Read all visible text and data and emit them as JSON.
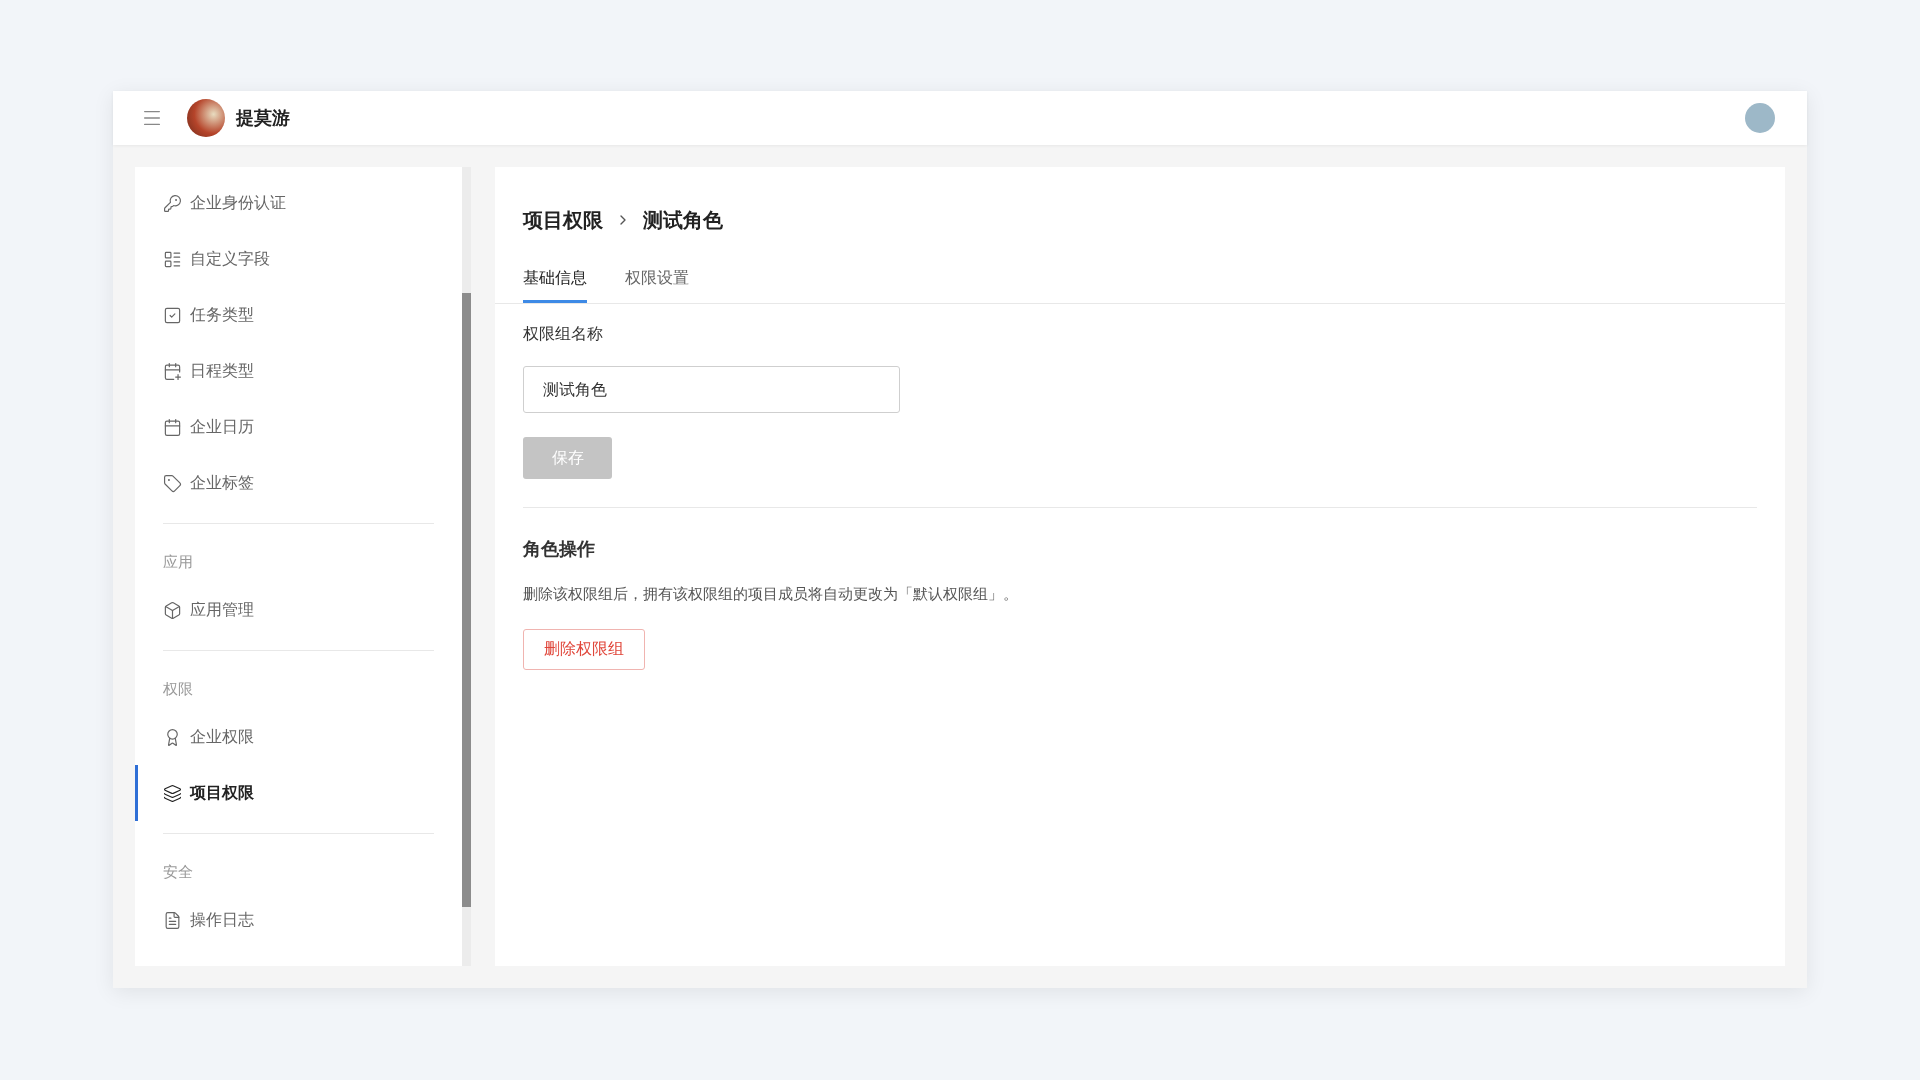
{
  "header": {
    "title": "提莫游"
  },
  "sidebar": {
    "groups": [
      {
        "items": [
          {
            "label": "企业身份认证",
            "selected": false
          },
          {
            "label": "自定义字段",
            "selected": false
          },
          {
            "label": "任务类型",
            "selected": false
          },
          {
            "label": "日程类型",
            "selected": false
          },
          {
            "label": "企业日历",
            "selected": false
          },
          {
            "label": "企业标签",
            "selected": false
          }
        ]
      },
      {
        "title": "应用",
        "items": [
          {
            "label": "应用管理",
            "selected": false
          }
        ]
      },
      {
        "title": "权限",
        "items": [
          {
            "label": "企业权限",
            "selected": false
          },
          {
            "label": "项目权限",
            "selected": true
          }
        ]
      },
      {
        "title": "安全",
        "items": [
          {
            "label": "操作日志",
            "selected": false
          }
        ]
      }
    ]
  },
  "breadcrumb": [
    "项目权限",
    "测试角色"
  ],
  "tabs": [
    {
      "label": "基础信息",
      "selected": true
    },
    {
      "label": "权限设置",
      "selected": false
    }
  ],
  "form": {
    "label": "权限组名称",
    "value": "测试角色",
    "save_button": {
      "label": "保存",
      "disabled": true
    }
  },
  "danger": {
    "title": "角色操作",
    "description": "删除该权限组后，拥有该权限组的项目成员将自动更改为「默认权限组」。",
    "button": "删除权限组"
  }
}
